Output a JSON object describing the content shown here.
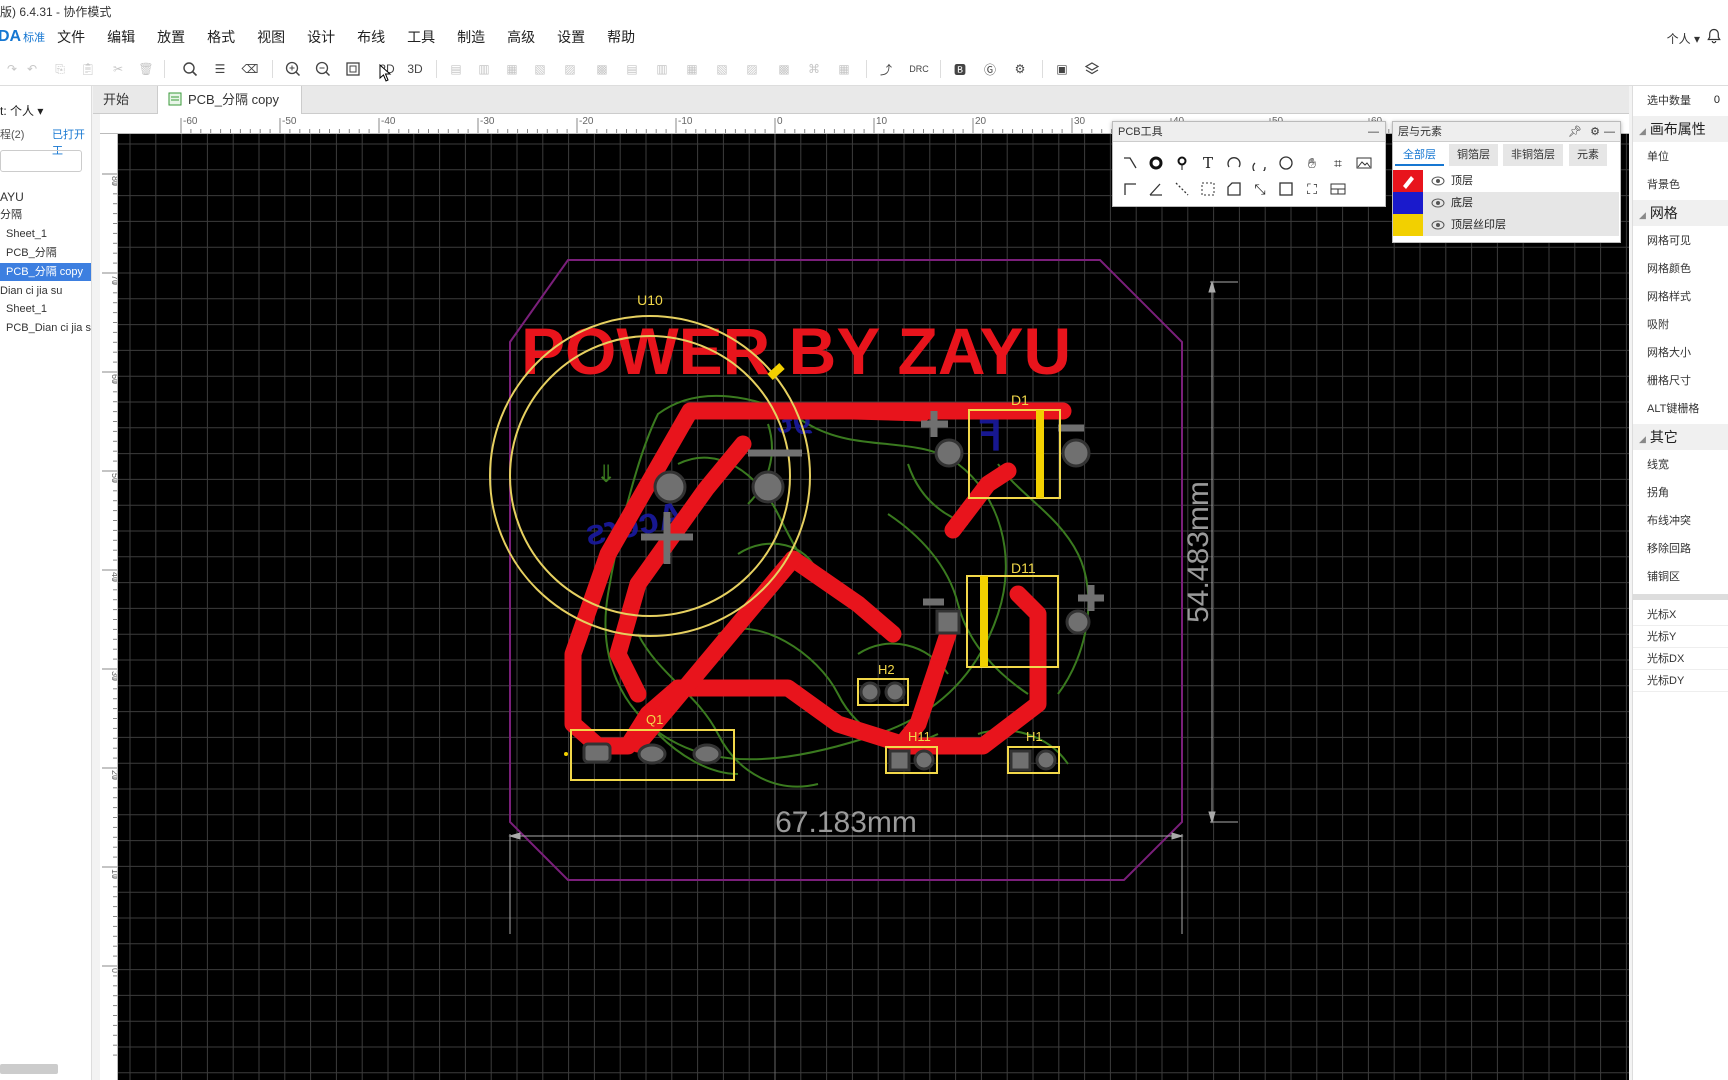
{
  "window": {
    "title": "版) 6.4.31 - 协作模式"
  },
  "app": {
    "logo": "DA",
    "logo_sub": "标准"
  },
  "menu": [
    "文件",
    "编辑",
    "放置",
    "格式",
    "视图",
    "设计",
    "布线",
    "工具",
    "制造",
    "高级",
    "设置",
    "帮助"
  ],
  "user": {
    "label": "个人"
  },
  "toolbar": {
    "view2d": "2D",
    "view3d": "3D",
    "drc": "DRC"
  },
  "left_panel": {
    "scope": "t: 个人",
    "project_count": "程(2)",
    "opened": "已打开工",
    "tree": [
      {
        "label": "AYU",
        "selected": false
      },
      {
        "label": "分隔",
        "selected": false
      },
      {
        "label": "Sheet_1",
        "selected": false
      },
      {
        "label": "PCB_分隔",
        "selected": false
      },
      {
        "label": "PCB_分隔 copy",
        "selected": true
      },
      {
        "label": "Dian ci jia su",
        "selected": false
      },
      {
        "label": "Sheet_1",
        "selected": false
      },
      {
        "label": "PCB_Dian ci jia s",
        "selected": false
      }
    ]
  },
  "tabs": [
    {
      "label": "开始",
      "active": false
    },
    {
      "label": "PCB_分隔 copy",
      "active": true
    }
  ],
  "ruler": {
    "top_ticks": [
      "-60",
      "-50",
      "-40",
      "-30",
      "-20",
      "-10",
      "0",
      "10",
      "20",
      "30",
      "40",
      "50",
      "60"
    ],
    "left_ticks": [
      "80",
      "70",
      "60",
      "50",
      "40",
      "30",
      "20",
      "10",
      "0"
    ]
  },
  "pcb": {
    "silk_title": "POWER BY ZAYU",
    "dim_width": "67.183mm",
    "dim_height": "54.483mm",
    "designators": [
      "U10",
      "D1",
      "D11",
      "H2",
      "Q1",
      "H11",
      "H1"
    ],
    "colors": {
      "top_copper": "#e8141c",
      "silkscreen": "#f2d84a",
      "bottom_silk": "#3a7a1f",
      "outline": "#7a1f7a",
      "bottom_text": "#1a1aa0",
      "grid": "#3c3c3c"
    }
  },
  "pcb_tools": {
    "title": "PCB工具"
  },
  "layers_panel": {
    "title": "层与元素",
    "tabs": [
      "全部层",
      "铜箔层",
      "非铜箔层",
      "元素"
    ],
    "layers": [
      {
        "name": "顶层",
        "color": "#e8141c"
      },
      {
        "name": "底层",
        "color": "#1a1acc"
      },
      {
        "name": "顶层丝印层",
        "color": "#f2d000"
      }
    ]
  },
  "right_panel": {
    "selected_count_label": "选中数量",
    "selected_count": "0",
    "section_canvas": "画布属性",
    "canvas_items": [
      "单位",
      "背景色"
    ],
    "section_grid": "网格",
    "grid_items": [
      "网格可见",
      "网格颜色",
      "网格样式",
      "吸附",
      "网格大小",
      "栅格尺寸",
      "ALT键栅格"
    ],
    "section_other": "其它",
    "other_items": [
      "线宽",
      "拐角",
      "布线冲突",
      "移除回路",
      "铺铜区"
    ],
    "cursor_items": [
      "光标X",
      "光标Y",
      "光标DX",
      "光标DY"
    ]
  }
}
